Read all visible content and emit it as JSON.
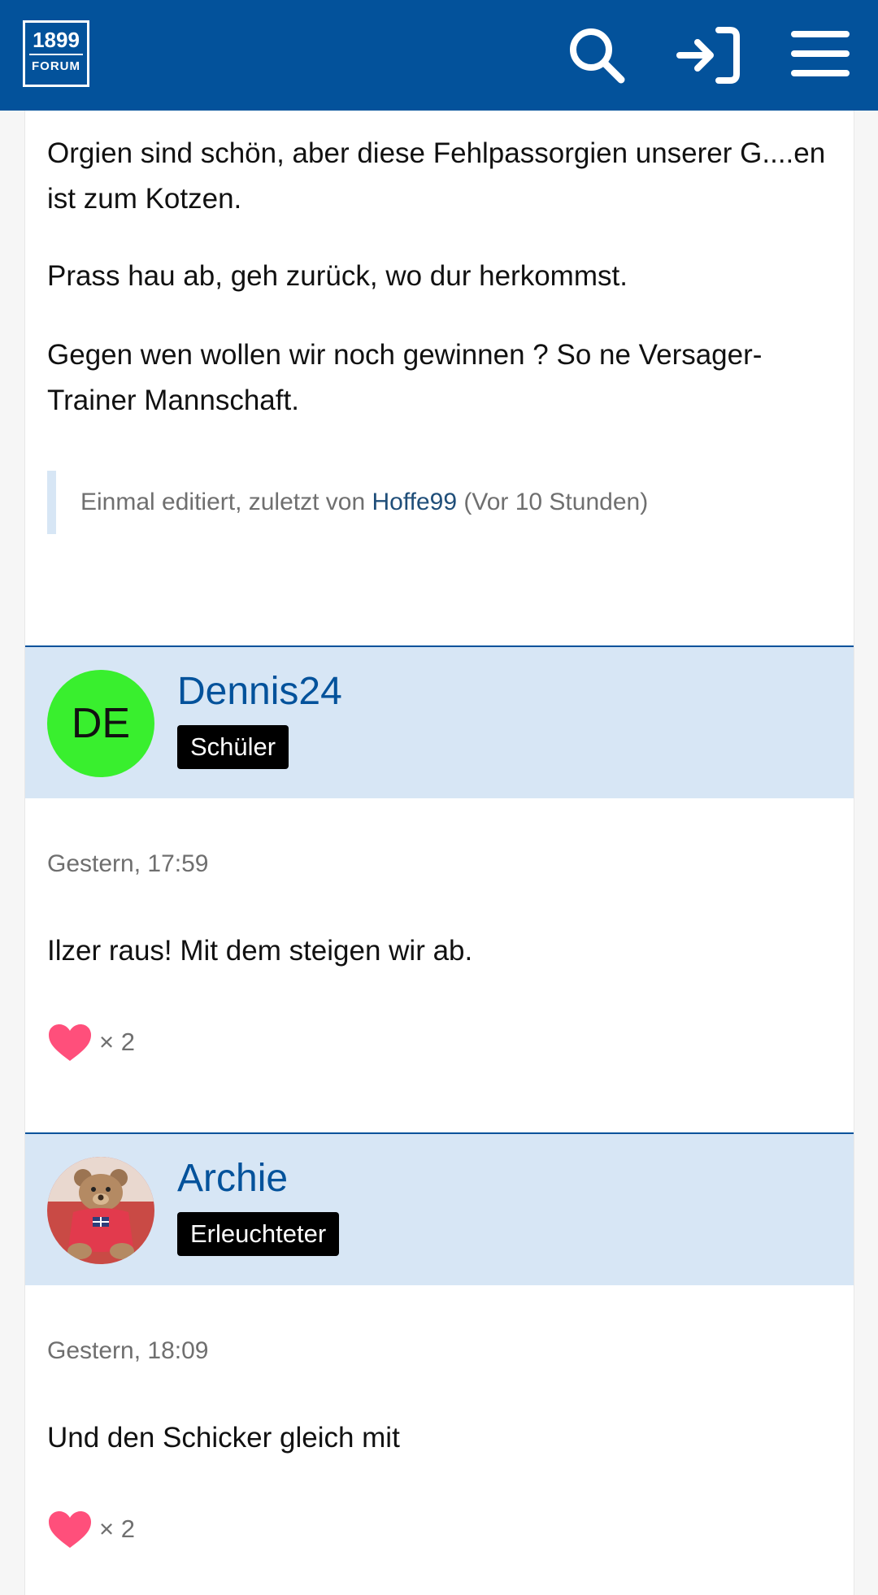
{
  "header": {
    "logo_year": "1899",
    "logo_word": "FORUM",
    "icons": [
      "search-icon",
      "login-icon",
      "menu-icon"
    ],
    "color": "#03529b"
  },
  "previous_post": {
    "paragraphs": [
      "Orgien sind schön, aber diese Fehlpassorgien unserer G....en ist zum Kotzen.",
      "Prass hau ab, geh zurück, wo dur herkommst.",
      "Gegen wen wollen wir noch gewinnen ? So ne Versager-Trainer Mannschaft."
    ],
    "edit_note": {
      "prefix": "Einmal editiert, zuletzt von ",
      "user": "Hoffe99",
      "suffix": " (Vor 10 Stunden)"
    }
  },
  "posts": [
    {
      "username": "Dennis24",
      "initials": "DE",
      "avatar_color": "#39ef2e",
      "rank": "Schüler",
      "time": "Gestern, 17:59",
      "text": "Ilzer raus! Mit dem steigen wir ab.",
      "reaction_count": "× 2"
    },
    {
      "username": "Archie",
      "avatar_icon": "teddy-bear-avatar",
      "rank": "Erleuchteter",
      "time": "Gestern, 18:09",
      "text": "Und den Schicker gleich mit",
      "reaction_count": "× 2"
    }
  ],
  "colors": {
    "header_bg": "#d7e6f5",
    "heart": "#ff4f7b",
    "link": "#03529b"
  }
}
